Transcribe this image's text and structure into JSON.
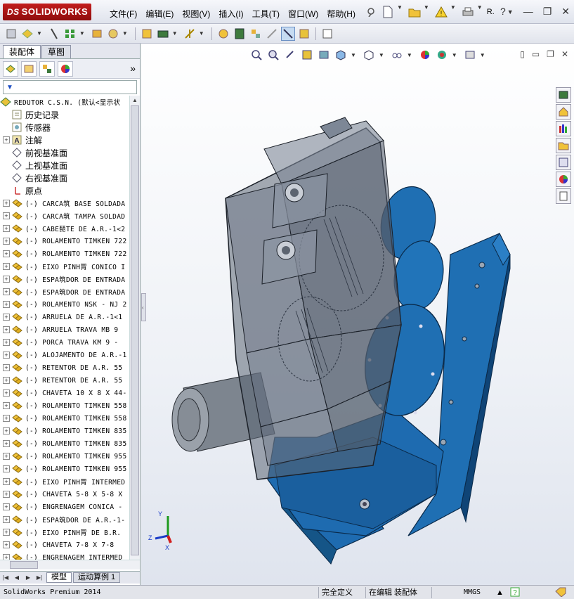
{
  "app": {
    "brand": "SOLIDWORKS",
    "brand_prefix": "DS"
  },
  "menu": [
    "文件(F)",
    "编辑(E)",
    "视图(V)",
    "插入(I)",
    "工具(T)",
    "窗口(W)",
    "帮助(H)"
  ],
  "title_extra": "R.",
  "panel": {
    "tabs": [
      "装配体",
      "草图"
    ],
    "bottom_tabs": [
      "模型",
      "运动算例 1"
    ]
  },
  "tree": {
    "root": "REDUTOR C.S.N.  (默认<显示状",
    "features": [
      {
        "label": "历史记录",
        "icon": "history-icon",
        "expandable": false
      },
      {
        "label": "传感器",
        "icon": "sensor-icon",
        "expandable": false
      },
      {
        "label": "注解",
        "icon": "annotation-icon",
        "expandable": true
      },
      {
        "label": "前视基准面",
        "icon": "plane-icon",
        "expandable": false
      },
      {
        "label": "上视基准面",
        "icon": "plane-icon",
        "expandable": false
      },
      {
        "label": "右视基准面",
        "icon": "plane-icon",
        "expandable": false
      },
      {
        "label": "原点",
        "icon": "origin-icon",
        "expandable": false
      }
    ],
    "components": [
      "(-) CARCA筑 BASE SOLDADA",
      "(-) CARCA筑 TAMPA SOLDAD",
      "(-) CABE琵TE DE A.R.-1<2",
      "(-) ROLAMENTO TIMKEN 722",
      "(-) ROLAMENTO TIMKEN 722",
      "(-) EIXO PINH冐 CONICO I",
      "(-) ESPA筑DOR DE ENTRADA",
      "(-) ESPA筑DOR DE ENTRADA",
      "(-) ROLAMENTO NSK - NJ 2",
      "(-) ARRUELA DE A.R.-1<1",
      "(-) ARRUELA TRAVA  MB 9",
      "(-) PORCA TRAVA  KM 9 -",
      "(-) ALOJAMENTO DE A.R.-1",
      "(-) RETENTOR DE A.R.  55",
      "(-) RETENTOR DE A.R.  55",
      "(-) CHAVETA 10 X 8 X 44-",
      "(-) ROLAMENTO TIMKEN 558",
      "(-) ROLAMENTO TIMKEN 558",
      "(-) ROLAMENTO TIMKEN 835",
      "(-) ROLAMENTO TIMKEN 835",
      "(-) ROLAMENTO TIMKEN 955",
      "(-) ROLAMENTO TIMKEN 955",
      "(-) EIXO PINH冐 INTERMED",
      "(-) CHAVETA 5-8 X 5-8 X",
      "(-) ENGRENAGEM CONICA -",
      "(-) ESPA筑DOR DE A.R.-1-",
      "(-) EIXO PINH冐 DE B.R.",
      "(-) CHAVETA 7-8  X 7-8",
      "(-) ENGRENAGEM INTERMED"
    ]
  },
  "triad": {
    "x": "X",
    "y": "Y",
    "z": "Z"
  },
  "status": {
    "product": "SolidWorks Premium 2014",
    "definition": "完全定义",
    "editing": "在编辑 装配体",
    "units": "MMGS"
  },
  "colors": {
    "model_blue": "#1f6fb3",
    "housing_gray": "#5b6675"
  }
}
